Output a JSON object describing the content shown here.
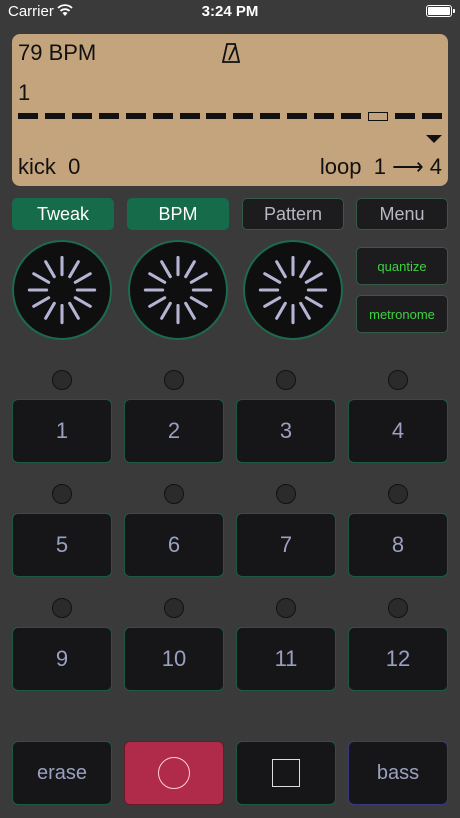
{
  "status_bar": {
    "carrier": "Carrier",
    "time": "3:24 PM"
  },
  "display": {
    "bpm": "79 BPM",
    "bar": "1",
    "step_count": 16,
    "current_step": 14,
    "instrument": "kick",
    "instrument_value": "0",
    "loop_label": "loop",
    "loop_from": "1",
    "loop_arrow": "⟶",
    "loop_to": "4"
  },
  "tabs": [
    {
      "label": "Tweak",
      "active": true
    },
    {
      "label": "BPM",
      "active": true
    },
    {
      "label": "Pattern",
      "active": false
    },
    {
      "label": "Menu",
      "active": false
    }
  ],
  "side_buttons": {
    "quantize": "quantize",
    "metronome": "metronome"
  },
  "pads": [
    "1",
    "2",
    "3",
    "4",
    "5",
    "6",
    "7",
    "8",
    "9",
    "10",
    "11",
    "12"
  ],
  "controls": {
    "erase": "erase",
    "instrument": "bass"
  },
  "colors": {
    "lcd_bg": "#c4a47c",
    "accent_green": "#156b4a",
    "record_red": "#b02a4a",
    "text_green": "#3fd13f"
  }
}
